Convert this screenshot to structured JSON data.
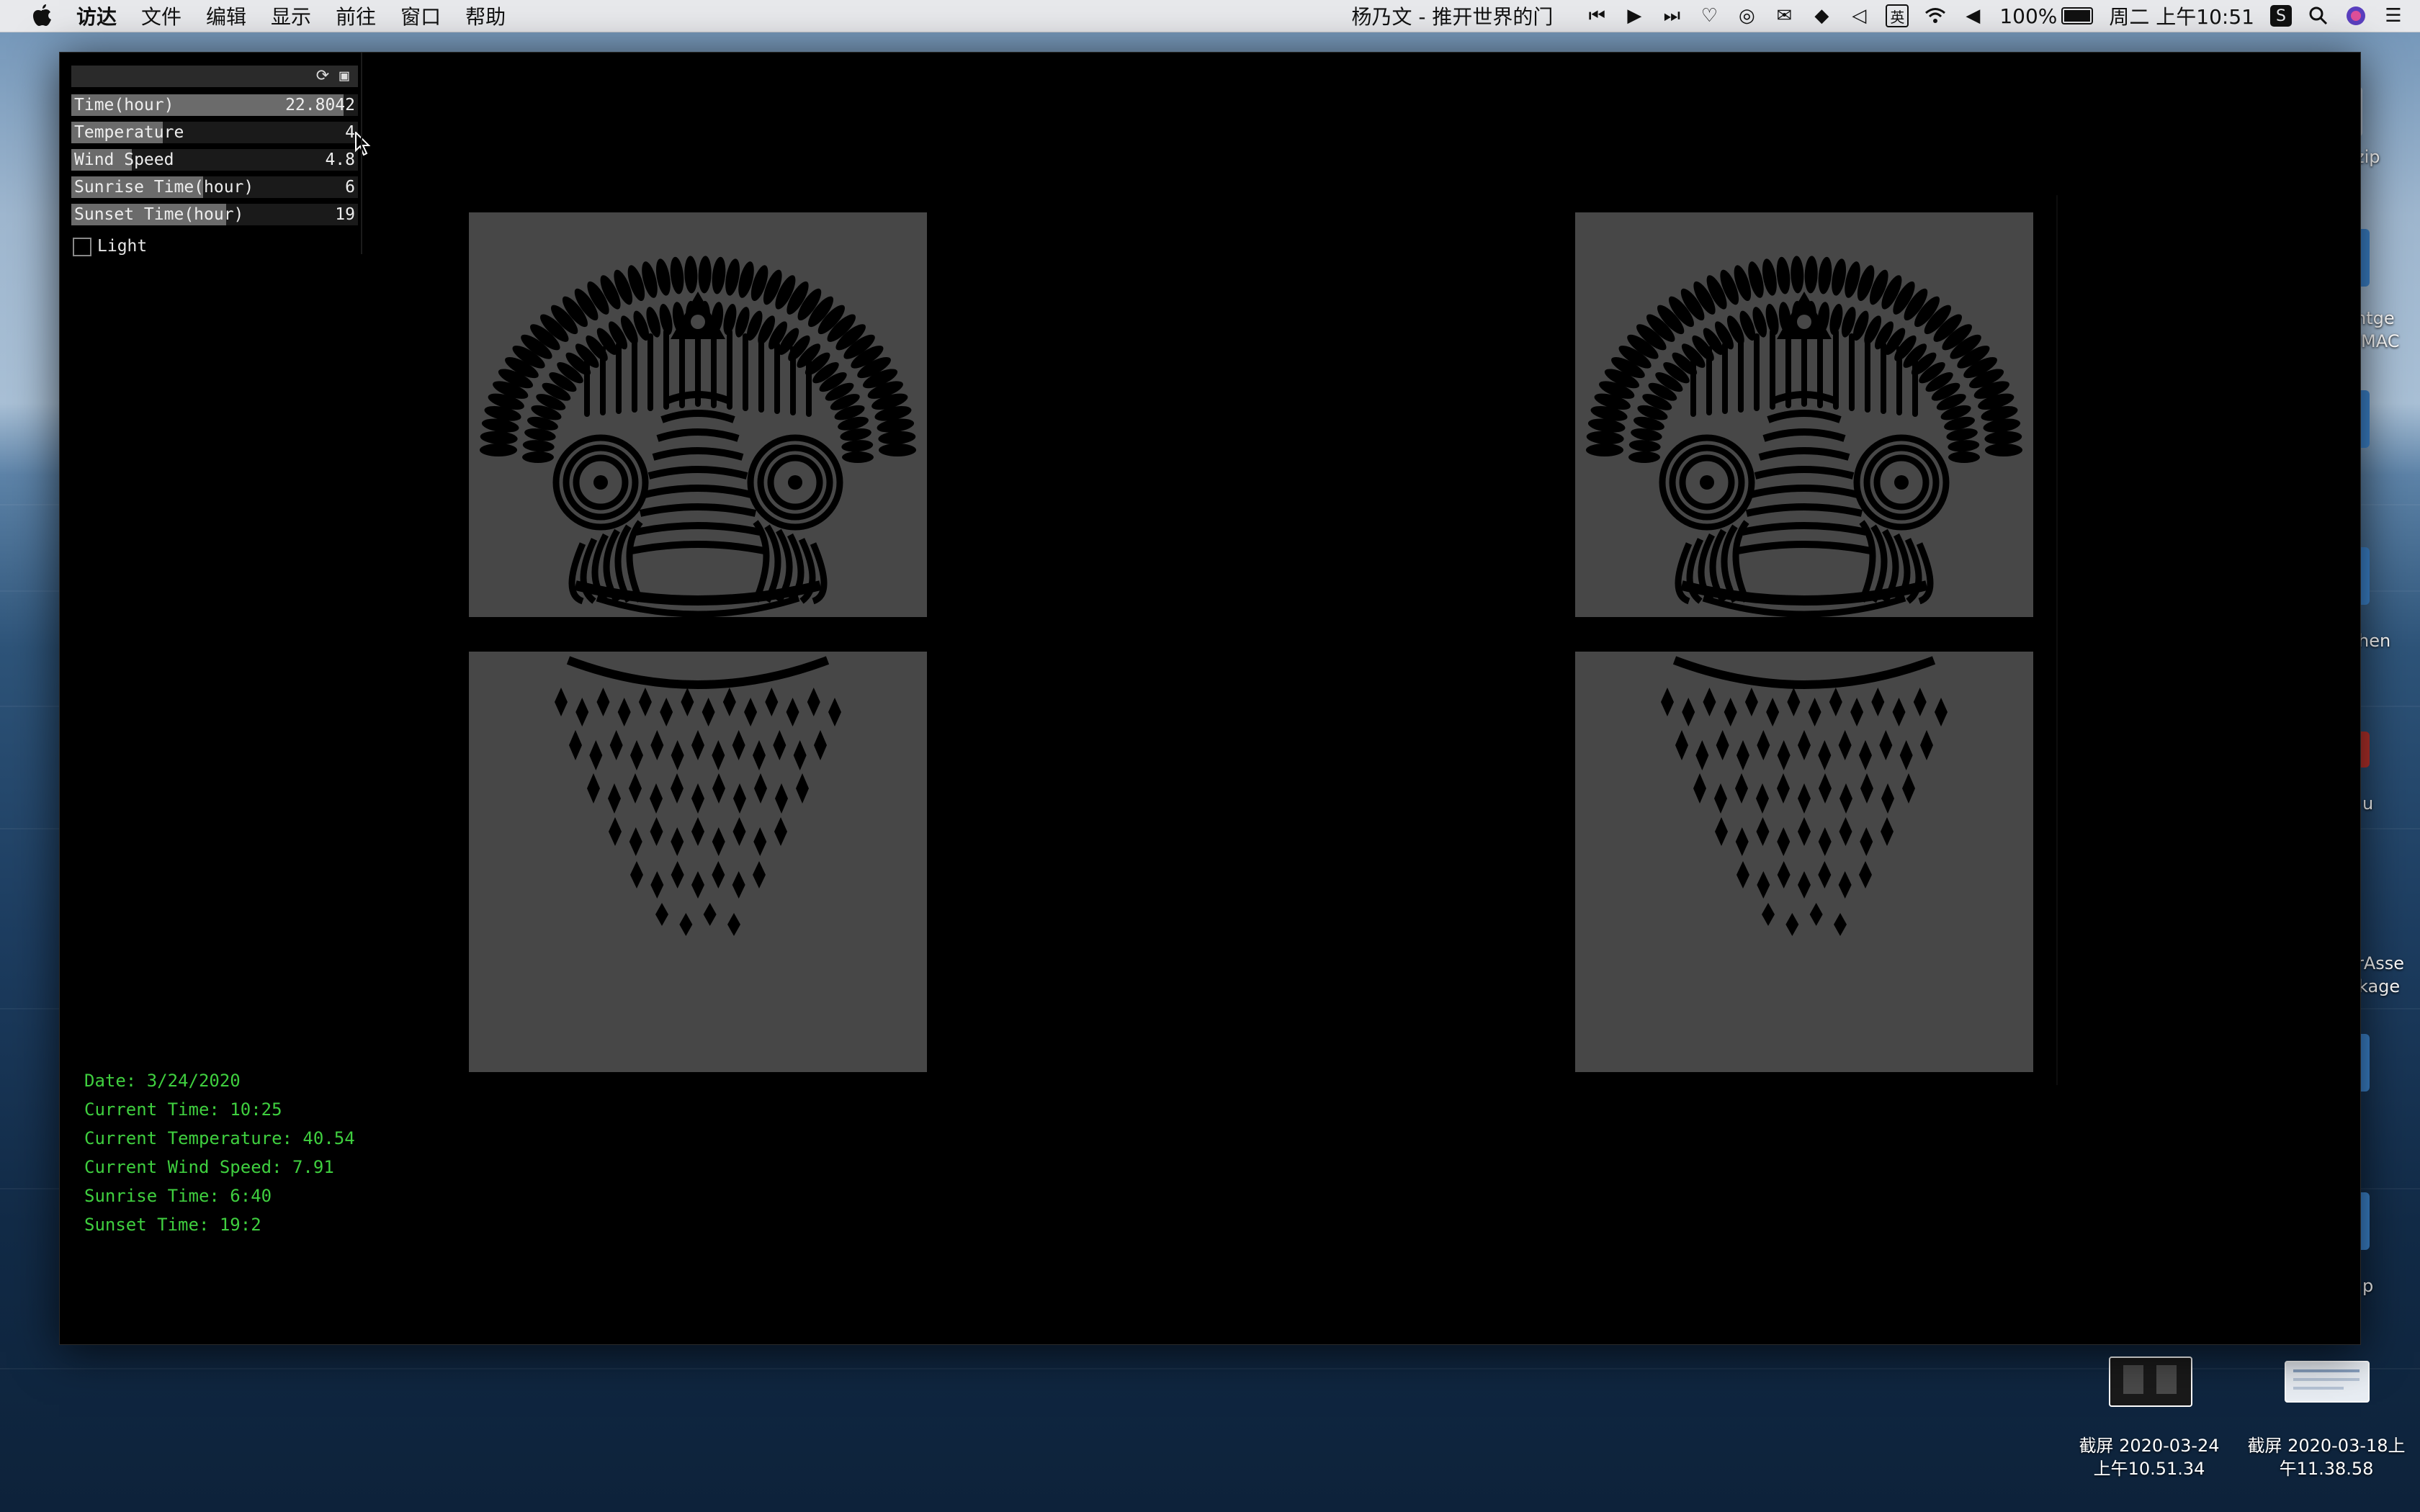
{
  "menubar": {
    "app_name": "访达",
    "menus": [
      "文件",
      "编辑",
      "显示",
      "前往",
      "窗口",
      "帮助"
    ],
    "now_playing": "杨乃文 - 推开世界的门",
    "battery": "100%",
    "clock": "周二 上午10:51",
    "icons": [
      "previous-track-icon",
      "play-icon",
      "next-track-icon",
      "heart-icon",
      "netease-music-icon",
      "wechat-icon",
      "dropbox-icon",
      "vscode-icon",
      "input-method-icon",
      "wifi-icon",
      "volume-icon",
      "battery-icon",
      "sogou-icon",
      "search-icon",
      "siri-icon",
      "notification-center-icon"
    ],
    "input_method_label": "英"
  },
  "gui": {
    "rows": [
      {
        "label": "Time(hour)",
        "value": "22.8042",
        "fill": 0.95
      },
      {
        "label": "Temperature",
        "value": "4",
        "fill": 0.32
      },
      {
        "label": "Wind Speed",
        "value": "4.8",
        "fill": 0.21
      },
      {
        "label": "Sunrise Time(hour)",
        "value": "6",
        "fill": 0.46
      },
      {
        "label": "Sunset Time(hour)",
        "value": "19",
        "fill": 0.54
      }
    ],
    "toggle": {
      "label": "Light",
      "checked": false
    }
  },
  "info": {
    "date": "Date: 3/24/2020",
    "current_time": "Current Time: 10:25",
    "current_temperature": "Current Temperature: 40.54",
    "current_wind_speed": "Current Wind Speed: 7.91",
    "sunrise_time": "Sunrise Time: 6:40",
    "sunset_time": "Sunset Time: 19:2"
  },
  "desktop": {
    "edge_labels": [
      "zip",
      "ntge",
      "MAC",
      "hen",
      "u",
      "rAsse",
      "kage",
      "p"
    ],
    "screenshots": [
      {
        "name_line1": "截屏 2020-03-24",
        "name_line2": "上午10.51.34"
      },
      {
        "name_line1": "截屏 2020-03-18上",
        "name_line2": "午11.38.58"
      }
    ]
  },
  "colors": {
    "panel": "#474747",
    "info_text": "#3fcf3f",
    "slider_fill": "#6b6b6b"
  }
}
